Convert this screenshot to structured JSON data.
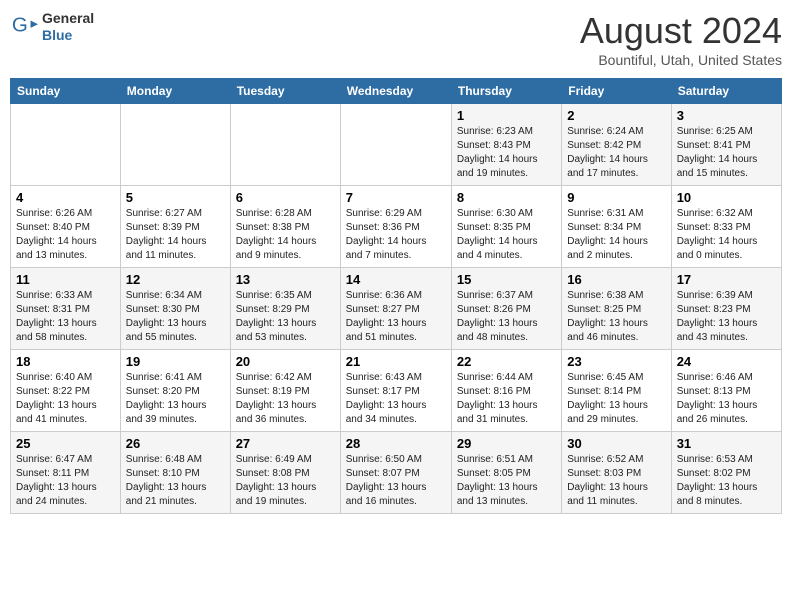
{
  "logo": {
    "general": "General",
    "blue": "Blue"
  },
  "title": "August 2024",
  "location": "Bountiful, Utah, United States",
  "days_of_week": [
    "Sunday",
    "Monday",
    "Tuesday",
    "Wednesday",
    "Thursday",
    "Friday",
    "Saturday"
  ],
  "weeks": [
    [
      {
        "num": "",
        "info": ""
      },
      {
        "num": "",
        "info": ""
      },
      {
        "num": "",
        "info": ""
      },
      {
        "num": "",
        "info": ""
      },
      {
        "num": "1",
        "info": "Sunrise: 6:23 AM\nSunset: 8:43 PM\nDaylight: 14 hours\nand 19 minutes."
      },
      {
        "num": "2",
        "info": "Sunrise: 6:24 AM\nSunset: 8:42 PM\nDaylight: 14 hours\nand 17 minutes."
      },
      {
        "num": "3",
        "info": "Sunrise: 6:25 AM\nSunset: 8:41 PM\nDaylight: 14 hours\nand 15 minutes."
      }
    ],
    [
      {
        "num": "4",
        "info": "Sunrise: 6:26 AM\nSunset: 8:40 PM\nDaylight: 14 hours\nand 13 minutes."
      },
      {
        "num": "5",
        "info": "Sunrise: 6:27 AM\nSunset: 8:39 PM\nDaylight: 14 hours\nand 11 minutes."
      },
      {
        "num": "6",
        "info": "Sunrise: 6:28 AM\nSunset: 8:38 PM\nDaylight: 14 hours\nand 9 minutes."
      },
      {
        "num": "7",
        "info": "Sunrise: 6:29 AM\nSunset: 8:36 PM\nDaylight: 14 hours\nand 7 minutes."
      },
      {
        "num": "8",
        "info": "Sunrise: 6:30 AM\nSunset: 8:35 PM\nDaylight: 14 hours\nand 4 minutes."
      },
      {
        "num": "9",
        "info": "Sunrise: 6:31 AM\nSunset: 8:34 PM\nDaylight: 14 hours\nand 2 minutes."
      },
      {
        "num": "10",
        "info": "Sunrise: 6:32 AM\nSunset: 8:33 PM\nDaylight: 14 hours\nand 0 minutes."
      }
    ],
    [
      {
        "num": "11",
        "info": "Sunrise: 6:33 AM\nSunset: 8:31 PM\nDaylight: 13 hours\nand 58 minutes."
      },
      {
        "num": "12",
        "info": "Sunrise: 6:34 AM\nSunset: 8:30 PM\nDaylight: 13 hours\nand 55 minutes."
      },
      {
        "num": "13",
        "info": "Sunrise: 6:35 AM\nSunset: 8:29 PM\nDaylight: 13 hours\nand 53 minutes."
      },
      {
        "num": "14",
        "info": "Sunrise: 6:36 AM\nSunset: 8:27 PM\nDaylight: 13 hours\nand 51 minutes."
      },
      {
        "num": "15",
        "info": "Sunrise: 6:37 AM\nSunset: 8:26 PM\nDaylight: 13 hours\nand 48 minutes."
      },
      {
        "num": "16",
        "info": "Sunrise: 6:38 AM\nSunset: 8:25 PM\nDaylight: 13 hours\nand 46 minutes."
      },
      {
        "num": "17",
        "info": "Sunrise: 6:39 AM\nSunset: 8:23 PM\nDaylight: 13 hours\nand 43 minutes."
      }
    ],
    [
      {
        "num": "18",
        "info": "Sunrise: 6:40 AM\nSunset: 8:22 PM\nDaylight: 13 hours\nand 41 minutes."
      },
      {
        "num": "19",
        "info": "Sunrise: 6:41 AM\nSunset: 8:20 PM\nDaylight: 13 hours\nand 39 minutes."
      },
      {
        "num": "20",
        "info": "Sunrise: 6:42 AM\nSunset: 8:19 PM\nDaylight: 13 hours\nand 36 minutes."
      },
      {
        "num": "21",
        "info": "Sunrise: 6:43 AM\nSunset: 8:17 PM\nDaylight: 13 hours\nand 34 minutes."
      },
      {
        "num": "22",
        "info": "Sunrise: 6:44 AM\nSunset: 8:16 PM\nDaylight: 13 hours\nand 31 minutes."
      },
      {
        "num": "23",
        "info": "Sunrise: 6:45 AM\nSunset: 8:14 PM\nDaylight: 13 hours\nand 29 minutes."
      },
      {
        "num": "24",
        "info": "Sunrise: 6:46 AM\nSunset: 8:13 PM\nDaylight: 13 hours\nand 26 minutes."
      }
    ],
    [
      {
        "num": "25",
        "info": "Sunrise: 6:47 AM\nSunset: 8:11 PM\nDaylight: 13 hours\nand 24 minutes."
      },
      {
        "num": "26",
        "info": "Sunrise: 6:48 AM\nSunset: 8:10 PM\nDaylight: 13 hours\nand 21 minutes."
      },
      {
        "num": "27",
        "info": "Sunrise: 6:49 AM\nSunset: 8:08 PM\nDaylight: 13 hours\nand 19 minutes."
      },
      {
        "num": "28",
        "info": "Sunrise: 6:50 AM\nSunset: 8:07 PM\nDaylight: 13 hours\nand 16 minutes."
      },
      {
        "num": "29",
        "info": "Sunrise: 6:51 AM\nSunset: 8:05 PM\nDaylight: 13 hours\nand 13 minutes."
      },
      {
        "num": "30",
        "info": "Sunrise: 6:52 AM\nSunset: 8:03 PM\nDaylight: 13 hours\nand 11 minutes."
      },
      {
        "num": "31",
        "info": "Sunrise: 6:53 AM\nSunset: 8:02 PM\nDaylight: 13 hours\nand 8 minutes."
      }
    ]
  ]
}
